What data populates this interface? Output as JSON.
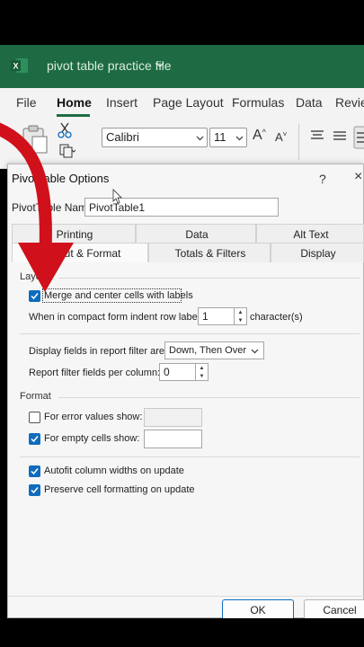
{
  "app": {
    "file_title": "pivot table practice file",
    "brand_color": "#1e6b43",
    "icon": "excel-logo-icon"
  },
  "ribbon_tabs": [
    "File",
    "Home",
    "Insert",
    "Page Layout",
    "Formulas",
    "Data",
    "Review"
  ],
  "ribbon": {
    "font_name": "Calibri",
    "font_size": "11",
    "grow_font": "A",
    "shrink_font": "A"
  },
  "dialog": {
    "title": "PivotTable Options",
    "help": "?",
    "close": "×",
    "name_label": "PivotTable Name:",
    "name_value": "PivotTable1",
    "tabs_row1": [
      "Printing",
      "Data",
      "Alt Text"
    ],
    "tabs_row2": [
      "Layout & Format",
      "Totals & Filters",
      "Display"
    ],
    "active_tab": "Layout & Format",
    "layout": {
      "group_label": "Layout",
      "merge_label": "Merge and center cells with labels",
      "merge_checked": true,
      "indent_label": "When in compact form indent row labels:",
      "indent_value": "1",
      "indent_unit": "character(s)",
      "display_fields_label": "Display fields in report filter area:",
      "display_fields_value": "Down, Then Over",
      "fields_per_column_label": "Report filter fields per column:",
      "fields_per_column_value": "0"
    },
    "format": {
      "group_label": "Format",
      "error_label": "For error values show:",
      "error_checked": false,
      "empty_label": "For empty cells show:",
      "empty_checked": true,
      "autofit_label": "Autofit column widths on update",
      "autofit_checked": true,
      "preserve_label": "Preserve cell formatting on update",
      "preserve_checked": true
    },
    "ok_label": "OK",
    "cancel_label": "Cancel"
  },
  "overlay": {
    "arrow_color": "#d0101a"
  }
}
